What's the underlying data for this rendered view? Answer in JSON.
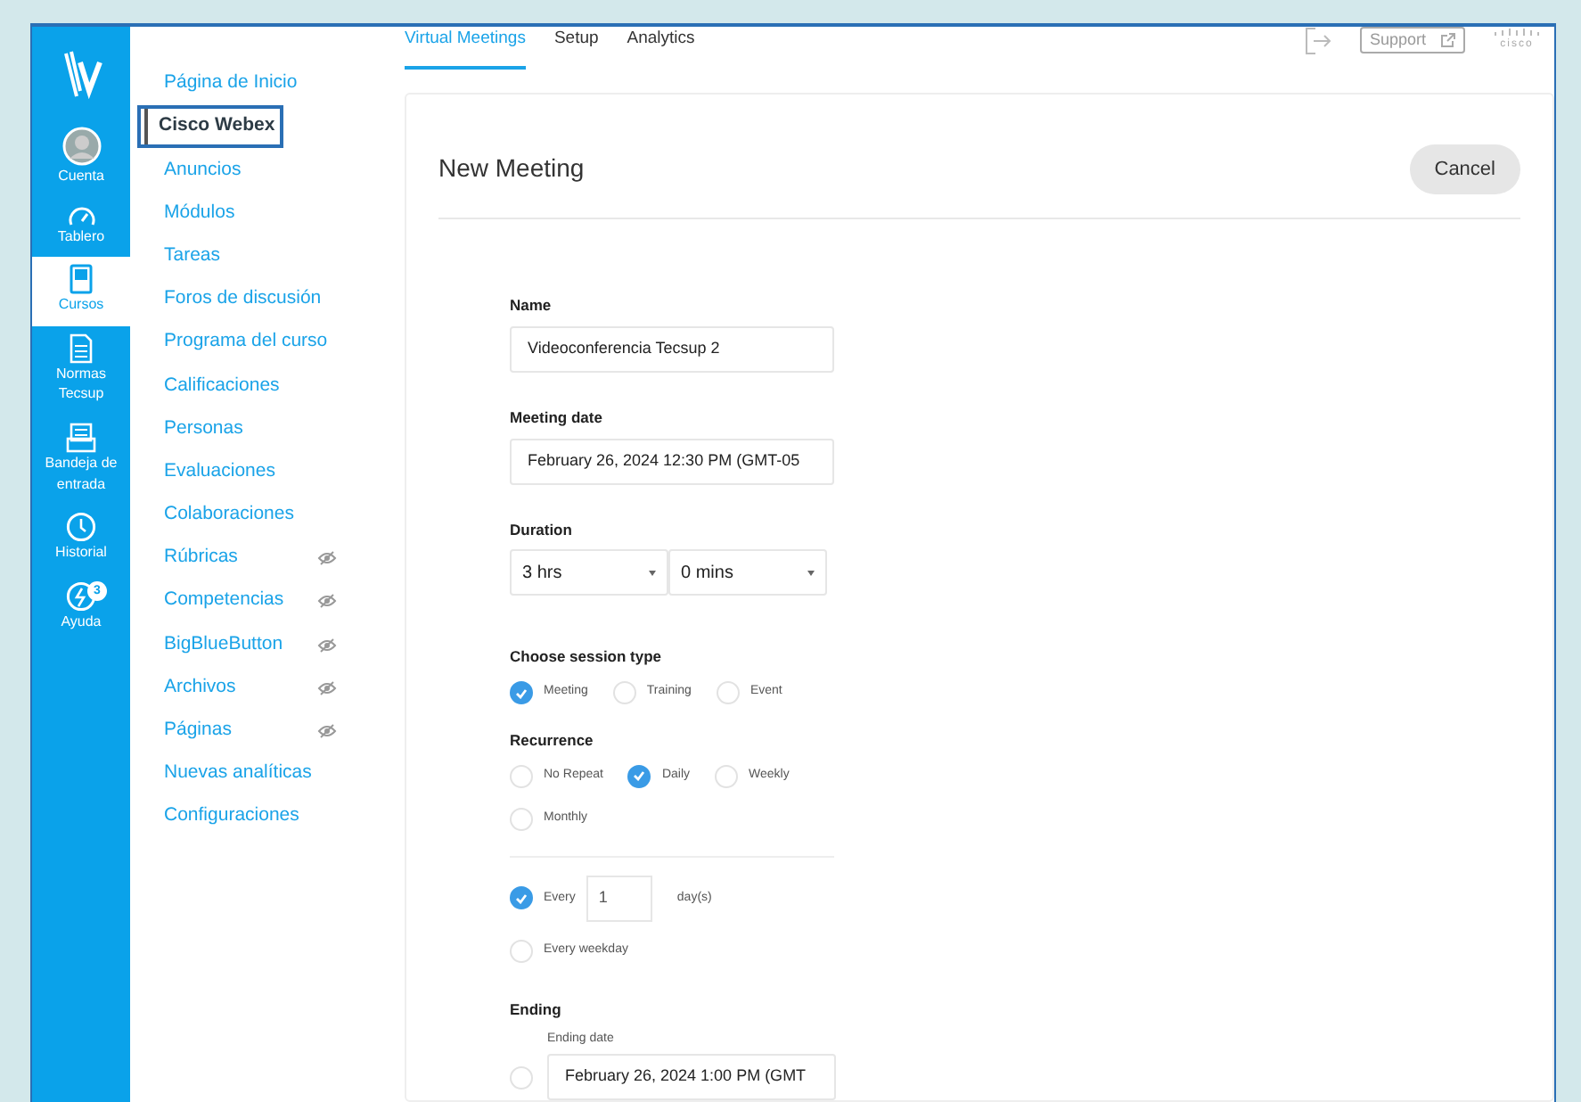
{
  "global_nav": [
    {
      "kind": "avatar",
      "label": "Cuenta",
      "selected": false
    },
    {
      "kind": "dashboard",
      "label": "Tablero",
      "selected": false
    },
    {
      "kind": "courses",
      "label": "Cursos",
      "selected": true
    },
    {
      "kind": "document",
      "label": "Normas Tecsup",
      "selected": false
    },
    {
      "kind": "inbox",
      "label": "Bandeja de entrada",
      "selected": false
    },
    {
      "kind": "clock",
      "label": "Historial",
      "selected": false
    },
    {
      "kind": "help",
      "label": "Ayuda",
      "selected": false,
      "badge": "3"
    }
  ],
  "course_nav": [
    {
      "label": "Página de Inicio",
      "selected": false,
      "hidden": false
    },
    {
      "label": "Cisco Webex",
      "selected": true,
      "hidden": false
    },
    {
      "label": "Anuncios",
      "selected": false,
      "hidden": false
    },
    {
      "label": "Módulos",
      "selected": false,
      "hidden": false
    },
    {
      "label": "Tareas",
      "selected": false,
      "hidden": false
    },
    {
      "label": "Foros de discusión",
      "selected": false,
      "hidden": false
    },
    {
      "label": "Programa del curso",
      "selected": false,
      "hidden": false
    },
    {
      "label": "Calificaciones",
      "selected": false,
      "hidden": false
    },
    {
      "label": "Personas",
      "selected": false,
      "hidden": false
    },
    {
      "label": "Evaluaciones",
      "selected": false,
      "hidden": false
    },
    {
      "label": "Colaboraciones",
      "selected": false,
      "hidden": false
    },
    {
      "label": "Rúbricas",
      "selected": false,
      "hidden": true
    },
    {
      "label": "Competencias",
      "selected": false,
      "hidden": true
    },
    {
      "label": "BigBlueButton",
      "selected": false,
      "hidden": true
    },
    {
      "label": "Archivos",
      "selected": false,
      "hidden": true
    },
    {
      "label": "Páginas",
      "selected": false,
      "hidden": true
    },
    {
      "label": "Nuevas analíticas",
      "selected": false,
      "hidden": false
    },
    {
      "label": "Configuraciones",
      "selected": false,
      "hidden": false
    }
  ],
  "tabs": [
    {
      "label": "Virtual Meetings",
      "selected": true
    },
    {
      "label": "Setup",
      "selected": false
    },
    {
      "label": "Analytics",
      "selected": false
    }
  ],
  "header": {
    "support": "Support",
    "logo_text": "cisco"
  },
  "card": {
    "title": "New Meeting",
    "cancel": "Cancel",
    "name": {
      "label": "Name",
      "value": "Videoconferencia Tecsup 2"
    },
    "meeting_date": {
      "label": "Meeting date",
      "value": "February 26, 2024 12:30 PM (GMT-05"
    },
    "duration": {
      "label": "Duration",
      "hours": "3 hrs",
      "minutes": "0 mins"
    },
    "session_type": {
      "label": "Choose session type",
      "options": [
        {
          "label": "Meeting",
          "selected": true
        },
        {
          "label": "Training",
          "selected": false
        },
        {
          "label": "Event",
          "selected": false
        }
      ]
    },
    "recurrence": {
      "label": "Recurrence",
      "options": [
        {
          "label": "No Repeat",
          "selected": false
        },
        {
          "label": "Daily",
          "selected": true
        },
        {
          "label": "Weekly",
          "selected": false
        },
        {
          "label": "Monthly",
          "selected": false
        }
      ]
    },
    "frequency": [
      {
        "kind": "every",
        "label": "Every",
        "value": "1",
        "unit": "day(s)",
        "selected": true
      },
      {
        "kind": "plain",
        "label": "Every weekday",
        "selected": false
      }
    ],
    "ending": {
      "label": "Ending",
      "options": [
        {
          "label": "Ending date",
          "value": "February 26, 2024 1:00 PM (GMT",
          "selected": false
        }
      ]
    }
  }
}
